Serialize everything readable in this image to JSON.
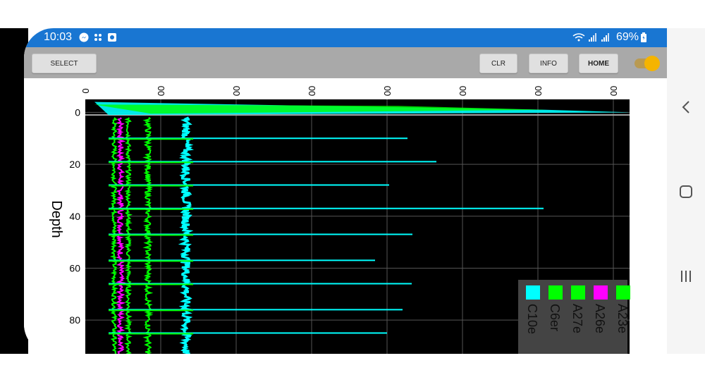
{
  "status_bar": {
    "time": "10:03",
    "battery": "69%",
    "icons": [
      "messenger-icon",
      "dots-app-icon",
      "gallery-icon",
      "wifi-icon",
      "signal-icon",
      "signal-icon",
      "battery-icon"
    ]
  },
  "toolbar": {
    "select_label": "SELECT",
    "clr_label": "CLR",
    "info_label": "INFO",
    "home_label": "HOME",
    "toggle_on": true
  },
  "navigation": {
    "icons": [
      "back-icon",
      "home-icon",
      "recents-icon"
    ]
  },
  "colors": {
    "status_bar": "#1976d2",
    "toolbar": "#a9a9a9",
    "plot_background": "#000000",
    "toggle": "#f5b400",
    "cyan": "#00ffff",
    "green": "#00ff00",
    "magenta": "#ff00ff"
  },
  "chart_data": {
    "type": "line",
    "ylabel": "Depth",
    "y_ticks": [
      "0",
      "20",
      "40",
      "60",
      "80"
    ],
    "x_ticks": [
      "0",
      "00",
      "00",
      "00",
      "00",
      "00",
      "00",
      "00"
    ],
    "ylim": [
      -5,
      93
    ],
    "y_inverted": true,
    "grid": true,
    "series": [
      {
        "name": "C10e",
        "color": "#00ffff"
      },
      {
        "name": "C6er",
        "color": "#00ff00"
      },
      {
        "name": "A27e",
        "color": "#00ff00"
      },
      {
        "name": "A26e",
        "color": "#ff00ff"
      },
      {
        "name": "A23e",
        "color": "#00ff00"
      }
    ],
    "legend": {
      "placement": "bottom-right"
    }
  }
}
